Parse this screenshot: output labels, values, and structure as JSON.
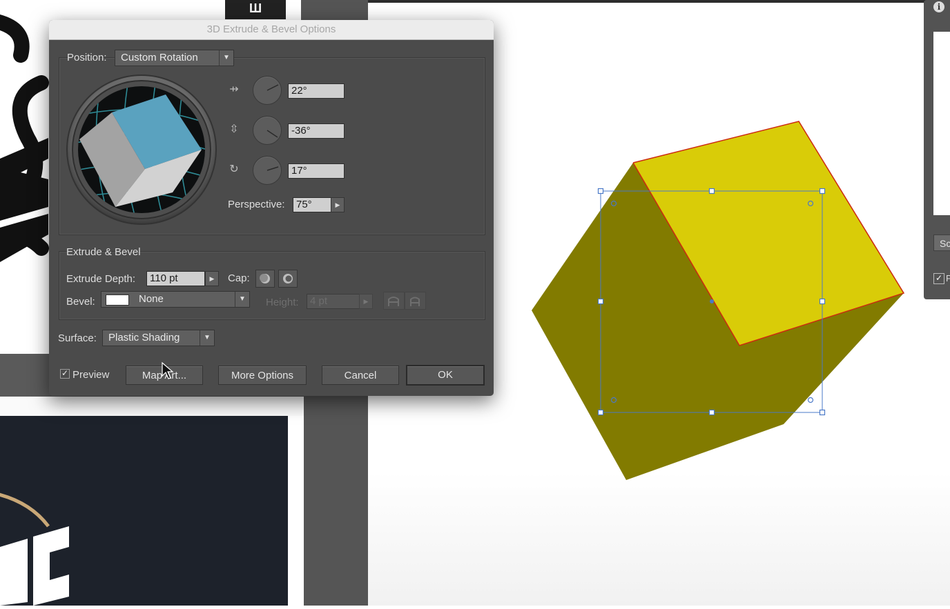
{
  "dialog": {
    "title": "3D Extrude & Bevel Options",
    "position": {
      "label": "Position:",
      "value": "Custom Rotation",
      "x_rotation": "22°",
      "y_rotation": "-36°",
      "z_rotation": "17°",
      "perspective_label": "Perspective:",
      "perspective_value": "75°"
    },
    "extrude_bevel": {
      "section_title": "Extrude & Bevel",
      "extrude_depth_label": "Extrude Depth:",
      "extrude_depth_value": "110 pt",
      "cap_label": "Cap:",
      "bevel_label": "Bevel:",
      "bevel_value": "None",
      "height_label": "Height:",
      "height_value": "4 pt"
    },
    "surface": {
      "label": "Surface:",
      "value": "Plastic Shading"
    },
    "preview": {
      "label": "Preview",
      "checked": true
    },
    "buttons": {
      "map_art": "Map Art...",
      "more_options": "More Options",
      "cancel": "Cancel",
      "ok": "OK"
    }
  },
  "workspace": {
    "tab_glyph": "Ш",
    "info_glyph": "i",
    "right_panel_button": "Sc",
    "right_panel_check_label": "P",
    "right_panel_checked": true
  },
  "colors": {
    "cube_top": "#d9cc08",
    "cube_side": "#827b00",
    "cube_edge": "#cc2a10",
    "selection": "#4a79c8",
    "dialog_bg": "#4b4b4b",
    "preview_cube_blue": "#5aa2bf"
  }
}
